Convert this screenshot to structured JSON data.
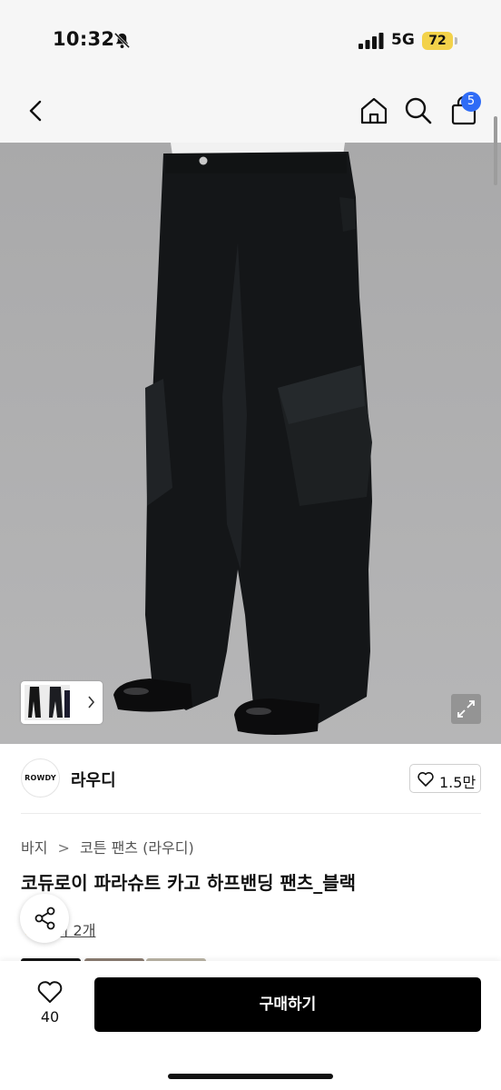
{
  "status_bar": {
    "time": "10:32",
    "network": "5G",
    "battery": "72"
  },
  "header": {
    "cart_count": "5"
  },
  "brand": {
    "logo_text": "ROWDY",
    "name": "라우디",
    "likes": "1.5만"
  },
  "breadcrumb": {
    "items": [
      "바지",
      "코튼 팬츠 (라우디)"
    ]
  },
  "product": {
    "title": "코듀로이 파라슈트 카고 하프밴딩 팬츠_블랙",
    "review_text": "후기 2개"
  },
  "bottom_bar": {
    "wish_count": "40",
    "buy_label": "구매하기"
  },
  "colors": {
    "accent_badge": "#2f6cf6",
    "battery": "#f3d24a",
    "buy_button": "#000000"
  }
}
